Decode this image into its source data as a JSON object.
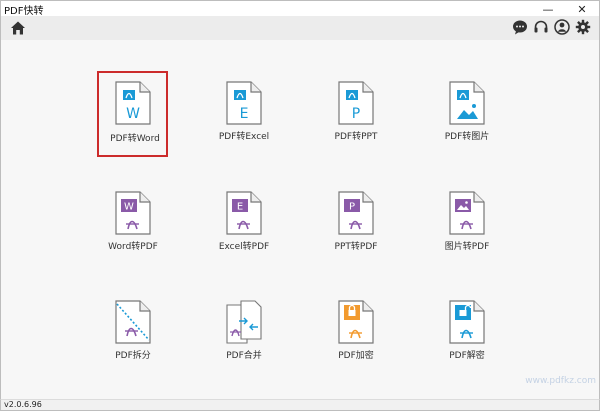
{
  "window": {
    "title": "PDF快转",
    "minimize": "—",
    "close": "✕"
  },
  "toolbar": {
    "icons": [
      "home-icon",
      "chat-icon",
      "headset-icon",
      "user-icon",
      "gear-icon"
    ]
  },
  "tools": [
    {
      "label": "PDF转Word",
      "letter": "W",
      "color": "#1a9ad6"
    },
    {
      "label": "PDF转Excel",
      "letter": "E",
      "color": "#1a9ad6"
    },
    {
      "label": "PDF转PPT",
      "letter": "P",
      "color": "#1a9ad6"
    },
    {
      "label": "PDF转图片",
      "letter": "",
      "color": "#1a9ad6"
    },
    {
      "label": "Word转PDF",
      "letter": "W",
      "color": "#8a5aa8"
    },
    {
      "label": "Excel转PDF",
      "letter": "E",
      "color": "#8a5aa8"
    },
    {
      "label": "PPT转PDF",
      "letter": "P",
      "color": "#8a5aa8"
    },
    {
      "label": "图片转PDF",
      "letter": "",
      "color": "#8a5aa8"
    },
    {
      "label": "PDF拆分",
      "letter": "",
      "color": "#1a9ad6"
    },
    {
      "label": "PDF合并",
      "letter": "",
      "color": "#1a9ad6"
    },
    {
      "label": "PDF加密",
      "letter": "",
      "color": "#f29a2e"
    },
    {
      "label": "PDF解密",
      "letter": "",
      "color": "#1a9ad6"
    }
  ],
  "status": {
    "version": "v2.0.6.96"
  },
  "watermark": "www.pdfkz.com"
}
